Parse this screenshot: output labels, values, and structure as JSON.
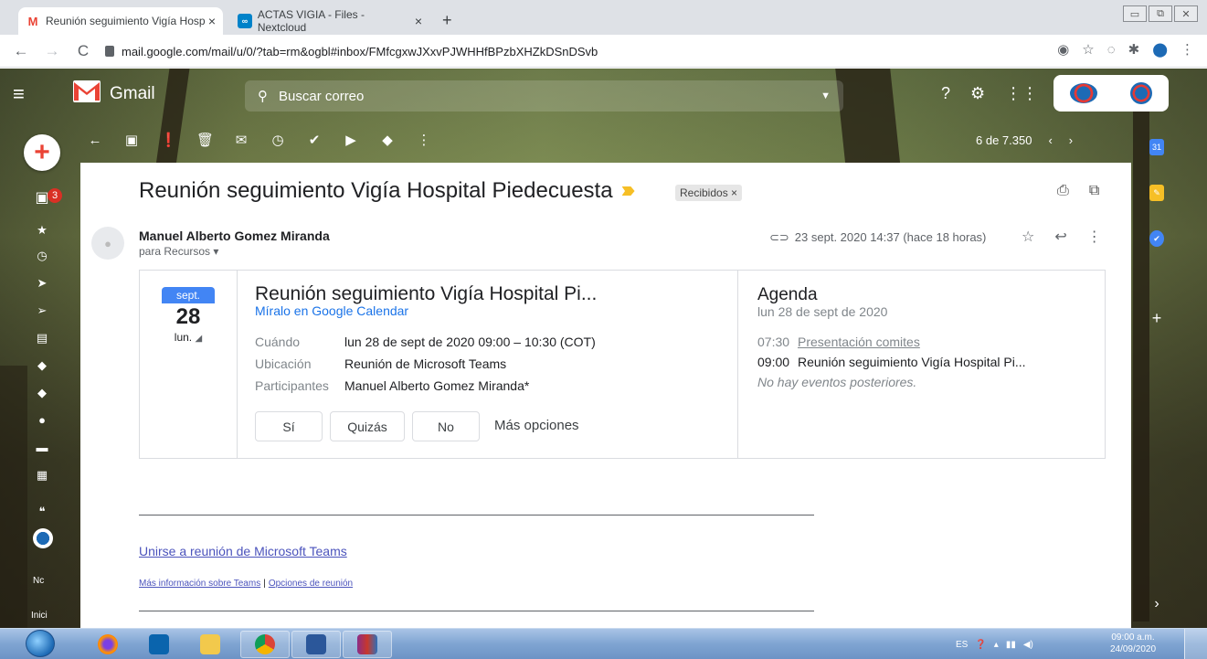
{
  "browser": {
    "tabs": [
      {
        "label": "Reunión seguimiento Vigía Hosp",
        "close": "×"
      },
      {
        "label": "ACTAS VIGIA - Files - Nextcloud",
        "close": "×"
      }
    ],
    "new_tab": "+",
    "url": "mail.google.com/mail/u/0/?tab=rm&ogbl#inbox/FMfcgxwJXxvPJWHHfBPzbXHZkDSnDSvb"
  },
  "gmail": {
    "brand": "Gmail",
    "search_placeholder": "Buscar correo",
    "pager": "6 de 7.350",
    "left_nav": {
      "inbox_badge": "3",
      "text1": "Nc",
      "text2": "Inici"
    }
  },
  "email": {
    "subject": "Reunión seguimiento Vigía Hospital Piedecuesta",
    "label": "Recibidos ×",
    "sender": "Manuel Alberto Gomez Miranda",
    "to": "para Recursos ▾",
    "date": "23 sept. 2020 14:37 (hace 18 horas)"
  },
  "invite": {
    "cal_month": "sept.",
    "cal_day": "28",
    "cal_weekday": "lun.",
    "title": "Reunión seguimiento Vigía Hospital Pi...",
    "calendar_link": "Míralo en Google Calendar",
    "when_label": "Cuándo",
    "when_value": "lun 28 de sept de 2020 09:00 – 10:30 (COT)",
    "where_label": "Ubicación",
    "where_value": "Reunión de Microsoft Teams",
    "who_label": "Participantes",
    "who_value": "Manuel Alberto Gomez Miranda*",
    "rsvp_yes": "Sí",
    "rsvp_maybe": "Quizás",
    "rsvp_no": "No",
    "more_options": "Más opciones"
  },
  "agenda": {
    "title": "Agenda",
    "date": "lun 28 de sept de 2020",
    "items": [
      {
        "time": "07:30",
        "title": "Presentación comites"
      },
      {
        "time": "09:00",
        "title": "Reunión seguimiento Vigía Hospital Pi..."
      }
    ],
    "none": "No hay eventos posteriores."
  },
  "teams": {
    "join": "Unirse a reunión de Microsoft Teams",
    "info": "Más información sobre Teams",
    "sep": "|",
    "options": "Opciones de reunión"
  },
  "taskbar": {
    "lang": "ES",
    "time": "09:00 a.m.",
    "date": "24/09/2020"
  },
  "colors": {
    "accent": "#1a73e8",
    "teams_link": "#4b53bc",
    "label_arrow": "#f6bf26",
    "badge": "#d93025",
    "calendar_blue": "#4285f4"
  }
}
